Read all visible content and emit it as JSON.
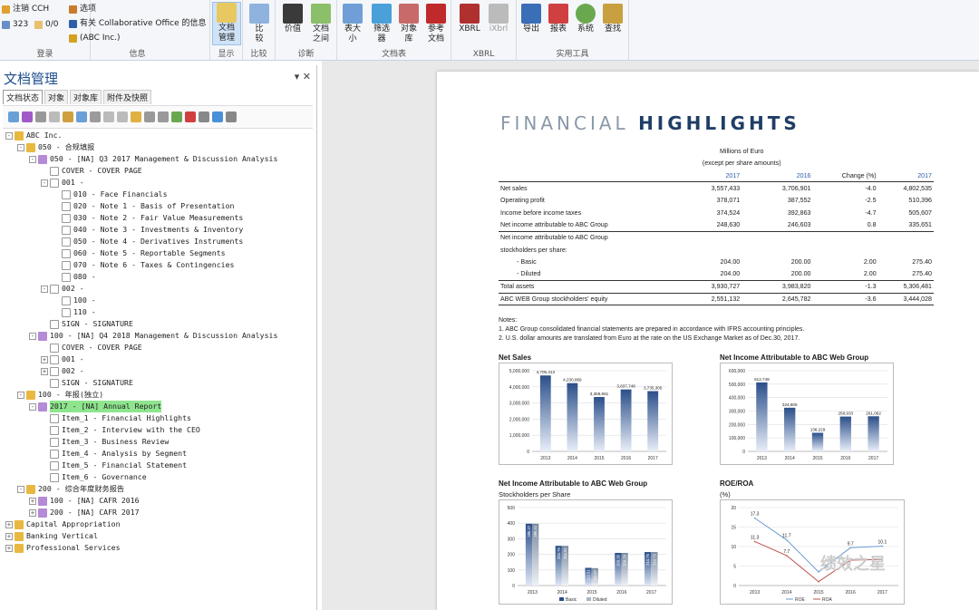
{
  "ribbon": {
    "login": {
      "logout": "注销 CCH",
      "user": "323",
      "count": "0/0",
      "label": "登录"
    },
    "info": {
      "options": "选项",
      "about": "有关 Collaborative Office 的信息",
      "company": "(ABC Inc.)",
      "label": "信息"
    },
    "display": {
      "doc_mgmt": "文档管理",
      "label": "显示"
    },
    "compare": {
      "compare": "比较",
      "label": "比较"
    },
    "diag": {
      "value": "价值",
      "doclink": "文档之间",
      "label": "诊断"
    },
    "docs": {
      "tablesize": "表大小",
      "filter": "筛选器",
      "objlib": "对象库",
      "refdoc": "参考文档",
      "label": "文档表"
    },
    "xbrl": {
      "xbrl": "XBRL",
      "ixbrl": "iXbrl",
      "label": "XBRL"
    },
    "tools": {
      "export": "导出",
      "report": "报表",
      "system": "系统",
      "find": "查找",
      "label": "实用工具"
    }
  },
  "panel": {
    "title": "文档管理",
    "controls": "▾ ✕",
    "tabs": [
      "文档状态",
      "对象",
      "对象库",
      "附件及快照"
    ],
    "tree": [
      {
        "t": "ABC Inc.",
        "l": 0,
        "e": "-"
      },
      {
        "t": "050 - 合规填报",
        "l": 1,
        "e": "-"
      },
      {
        "t": "050 - [NA] Q3 2017 Management & Discussion Analysis",
        "l": 2,
        "e": "-"
      },
      {
        "t": "COVER - COVER PAGE",
        "l": 3,
        "e": ""
      },
      {
        "t": "001 -",
        "l": 3,
        "e": "-"
      },
      {
        "t": "010 - Face Financials",
        "l": 4,
        "e": ""
      },
      {
        "t": "020 - Note 1 - Basis of Presentation",
        "l": 4,
        "e": ""
      },
      {
        "t": "030 - Note 2 - Fair Value Measurements",
        "l": 4,
        "e": ""
      },
      {
        "t": "040 - Note 3 - Investments & Inventory",
        "l": 4,
        "e": ""
      },
      {
        "t": "050 - Note 4 - Derivatives Instruments",
        "l": 4,
        "e": ""
      },
      {
        "t": "060 - Note 5 - Reportable Segments",
        "l": 4,
        "e": ""
      },
      {
        "t": "070 - Note 6 - Taxes & Contingencies",
        "l": 4,
        "e": ""
      },
      {
        "t": "080 -",
        "l": 4,
        "e": ""
      },
      {
        "t": "002 -",
        "l": 3,
        "e": "-"
      },
      {
        "t": "100 -",
        "l": 4,
        "e": ""
      },
      {
        "t": "110 -",
        "l": 4,
        "e": ""
      },
      {
        "t": "SIGN - SIGNATURE",
        "l": 3,
        "e": ""
      },
      {
        "t": "100 - [NA] Q4 2018 Management & Discussion Analysis",
        "l": 2,
        "e": "-"
      },
      {
        "t": "COVER - COVER PAGE",
        "l": 3,
        "e": ""
      },
      {
        "t": "001 -",
        "l": 3,
        "e": "+"
      },
      {
        "t": "002 -",
        "l": 3,
        "e": "+"
      },
      {
        "t": "SIGN - SIGNATURE",
        "l": 3,
        "e": ""
      },
      {
        "t": "100 - 年报(独立)",
        "l": 1,
        "e": "-"
      },
      {
        "t": "2017 - [NA] Annual Report",
        "l": 2,
        "e": "-",
        "hl": true
      },
      {
        "t": "Item_1 - Financial Highlights",
        "l": 3,
        "e": "",
        "sel": true
      },
      {
        "t": "Item_2 - Interview with the CEO",
        "l": 3,
        "e": ""
      },
      {
        "t": "Item_3 - Business Review",
        "l": 3,
        "e": ""
      },
      {
        "t": "Item_4 - Analysis by Segment",
        "l": 3,
        "e": ""
      },
      {
        "t": "Item_5 - Financial Statement",
        "l": 3,
        "e": ""
      },
      {
        "t": "Item_6 - Governance",
        "l": 3,
        "e": ""
      },
      {
        "t": "200 - 综合年度财务报告",
        "l": 1,
        "e": "-"
      },
      {
        "t": "100 - [NA] CAFR 2016",
        "l": 2,
        "e": "+"
      },
      {
        "t": "200 - [NA] CAFR 2017",
        "l": 2,
        "e": "+"
      },
      {
        "t": "Capital Appropriation",
        "l": 0,
        "e": "+"
      },
      {
        "t": "Banking Vertical",
        "l": 0,
        "e": "+"
      },
      {
        "t": "Professional Services",
        "l": 0,
        "e": "+"
      }
    ]
  },
  "document": {
    "title_light": "FINANCIAL ",
    "title_bold": "HIGHLIGHTS",
    "hdr": {
      "m1": "Millions of Euro",
      "m2": "(except per share amounts)",
      "y2017": "2017",
      "y2016": "2016",
      "chg": "Change (%)",
      "y2017b": "2017"
    },
    "rows": [
      {
        "k": "Net sales",
        "a": "3,557,433",
        "b": "3,706,901",
        "c": "-4.0",
        "d": "4,802,535",
        "top": true
      },
      {
        "k": "Operating profit",
        "a": "378,071",
        "b": "387,552",
        "c": "-2.5",
        "d": "510,396"
      },
      {
        "k": "Income before income taxes",
        "a": "374,524",
        "b": "392,863",
        "c": "-4.7",
        "d": "505,607"
      },
      {
        "k": "Net income attributable to ABC Group",
        "a": "248,630",
        "b": "246,603",
        "c": "0.8",
        "d": "335,651",
        "bb": true
      },
      {
        "k": "Net income attributable to ABC Group",
        "a": "",
        "b": "",
        "c": "",
        "d": ""
      },
      {
        "k": "stockholders per share:",
        "a": "",
        "b": "",
        "c": "",
        "d": ""
      },
      {
        "k": "- Basic",
        "a": "204.00",
        "b": "200.00",
        "c": "2.00",
        "d": "275.40",
        "ind": true
      },
      {
        "k": "- Diluted",
        "a": "204.00",
        "b": "200.00",
        "c": "2.00",
        "d": "275.40",
        "ind": true,
        "bb": true
      },
      {
        "k": "Total assets",
        "a": "3,930,727",
        "b": "3,983,820",
        "c": "-1.3",
        "d": "5,306,481",
        "bb": true
      },
      {
        "k": "ABC WEB Group stockholders' equity",
        "a": "2,551,132",
        "b": "2,645,782",
        "c": "-3.6",
        "d": "3,444,028",
        "bb": true
      }
    ],
    "notes": [
      "Notes:",
      "1. ABC Group consolidated financial statements are prepared in accordance with IFRS accounting principles.",
      "2. U.S. dollar amounts are translated from Euro at the rate on the US Exchange Market as of Dec.30, 2017."
    ],
    "c1_title": "Net Sales",
    "c2_title": "Net Income Attributable to ABC Web Group",
    "c3_title": "Net Income Attributable to ABC Web Group",
    "c3_sub": "Stockholders per Share",
    "c4_title": "ROE/ROA",
    "c4_sub": "(%)"
  },
  "watermark": "绩效之星",
  "chart_data": [
    {
      "type": "bar",
      "title": "Net Sales",
      "categories": [
        "2013",
        "2014",
        "2015",
        "2016",
        "2017"
      ],
      "values": [
        4705413,
        4230869,
        3369661,
        3837748,
        3735305
      ],
      "ylim": [
        0,
        5000000
      ],
      "yticks": [
        0,
        1000000,
        2000000,
        3000000,
        4000000,
        5000000
      ],
      "labels": [
        "4,705,413",
        "4,230,869",
        "3,369,661",
        "3,837,748",
        "3,735,305"
      ],
      "ytl": [
        "0",
        "1,000,000",
        "2,000,000",
        "3,000,000",
        "4,000,000",
        "5,000,000"
      ]
    },
    {
      "type": "bar",
      "title": "Net Income Attributable to ABC Web Group",
      "categories": [
        "2013",
        "2014",
        "2015",
        "2016",
        "2017"
      ],
      "values": [
        512749,
        324605,
        138229,
        258933,
        261062
      ],
      "ylim": [
        0,
        600000
      ],
      "yticks": [
        0,
        100000,
        200000,
        300000,
        400000,
        500000,
        600000
      ],
      "labels": [
        "512,749",
        "324,605",
        "138,229",
        "258,933",
        "261,062"
      ],
      "ytl": [
        "0",
        "100,000",
        "200,000",
        "300,000",
        "400,000",
        "500,000",
        "600,000"
      ]
    },
    {
      "type": "bar",
      "title": "Net Income Attributable to ABC Web Group",
      "categories": [
        "2013",
        "2014",
        "2015",
        "2016",
        "2017"
      ],
      "series": [
        {
          "name": "Basic",
          "values": [
            396.47,
            254.75,
            113.51,
            209.35,
            214.76
          ]
        },
        {
          "name": "Diluted",
          "values": [
            396.41,
            254.51,
            111.57,
            209.29,
            214.75
          ]
        }
      ],
      "ylim": [
        0,
        500
      ],
      "yticks": [
        0,
        100,
        200,
        300,
        400,
        500
      ],
      "legend": "bottom"
    },
    {
      "type": "line",
      "title": "ROE/ROA",
      "categories": [
        "2013",
        "2014",
        "2015",
        "2016",
        "2017"
      ],
      "series": [
        {
          "name": "ROE",
          "values": [
            17.3,
            11.7,
            3.5,
            9.7,
            10.1
          ]
        },
        {
          "name": "ROA",
          "values": [
            11.3,
            7.7,
            1.0,
            6.5,
            6.7
          ]
        }
      ],
      "ylim": [
        0,
        20
      ],
      "yticks": [
        0,
        5,
        10,
        15,
        20
      ],
      "legend": "bottom",
      "labels": [
        "17.3",
        "11.7",
        "9.7",
        "10.1",
        "11.3",
        "7.7"
      ]
    }
  ]
}
